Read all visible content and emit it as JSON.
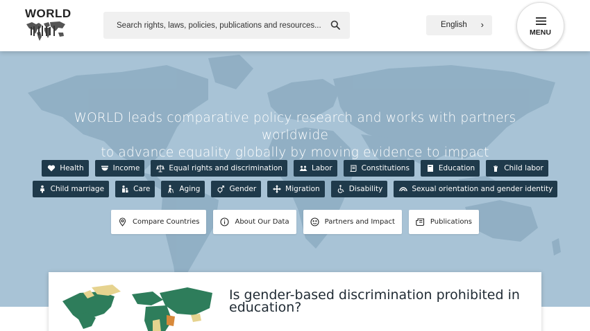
{
  "header": {
    "logo_text": "WORLD",
    "search": {
      "placeholder": "Search rights, laws, policies, publications and resources..."
    },
    "language": {
      "label": "English",
      "chevron": "›"
    },
    "menu": {
      "label": "MENU"
    }
  },
  "hero": {
    "tagline_line1": "WORLD leads comparative policy research and works with partners worldwide",
    "tagline_line2": "to advance equality globally by moving evidence to impact",
    "topics_row1": [
      {
        "label": "Health",
        "icon": "heart-icon"
      },
      {
        "label": "Income",
        "icon": "bowl-icon"
      },
      {
        "label": "Equal rights and discrimination",
        "icon": "scales-icon"
      },
      {
        "label": "Labor",
        "icon": "workers-icon"
      },
      {
        "label": "Constitutions",
        "icon": "scroll-icon"
      },
      {
        "label": "Education",
        "icon": "book-icon"
      },
      {
        "label": "Child labor",
        "icon": "hand-icon"
      }
    ],
    "topics_row2": [
      {
        "label": "Child marriage",
        "icon": "child-icon"
      },
      {
        "label": "Care",
        "icon": "care-icon"
      },
      {
        "label": "Aging",
        "icon": "walking-cane-icon"
      },
      {
        "label": "Gender",
        "icon": "gender-icon"
      },
      {
        "label": "Migration",
        "icon": "arrows-icon"
      },
      {
        "label": "Disability",
        "icon": "wheelchair-icon"
      },
      {
        "label": "Sexual orientation and gender identity",
        "icon": "rainbow-icon"
      }
    ],
    "actions": [
      {
        "label": "Compare Countries",
        "icon": "location-pin-icon"
      },
      {
        "label": "About Our Data",
        "icon": "info-icon"
      },
      {
        "label": "Partners and Impact",
        "icon": "globe-icon"
      },
      {
        "label": "Publications",
        "icon": "newspaper-icon"
      }
    ]
  },
  "card": {
    "title": "Is gender-based discrimination prohibited in education?"
  },
  "colors": {
    "hero_bg": "#a8c3d6",
    "chip_bg": "#1f3a4b",
    "map_green": "#2e7d5b",
    "map_tan": "#e6d38f"
  }
}
